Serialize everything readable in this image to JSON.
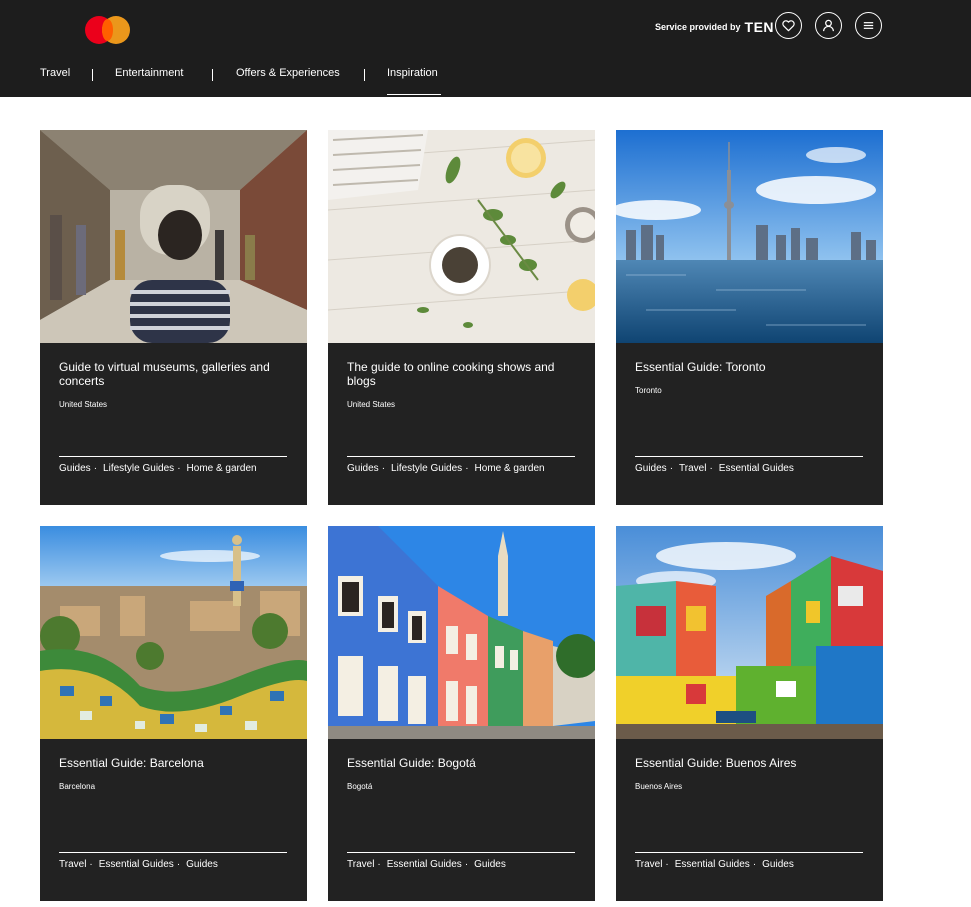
{
  "header": {
    "service_label": "Service provided by",
    "service_brand": "TEN",
    "logo_icon": "mastercard-logo",
    "buttons": [
      {
        "icon": "heart-icon"
      },
      {
        "icon": "user-icon"
      },
      {
        "icon": "menu-icon"
      }
    ],
    "nav": [
      {
        "label": "Travel",
        "active": false
      },
      {
        "label": "Entertainment",
        "active": false
      },
      {
        "label": "Offers & Experiences",
        "active": false
      },
      {
        "label": "Inspiration",
        "active": true
      }
    ]
  },
  "cards": [
    {
      "title": "Guide to virtual museums, galleries and concerts",
      "location": "United States",
      "image": "museum-hallway-photo",
      "tags": [
        "Guides",
        "Lifestyle Guides",
        "Home & garden"
      ]
    },
    {
      "title": "The guide to online cooking shows and blogs",
      "location": "United States",
      "image": "herbs-on-wooden-table-photo",
      "tags": [
        "Guides",
        "Lifestyle Guides",
        "Home & garden"
      ]
    },
    {
      "title": "Essential Guide: Toronto",
      "location": "Toronto",
      "image": "toronto-skyline-photo",
      "tags": [
        "Guides",
        "Travel",
        "Essential Guides"
      ]
    },
    {
      "title": "Essential Guide: Barcelona",
      "location": "Barcelona",
      "image": "park-guell-photo",
      "tags": [
        "Travel",
        "Essential Guides",
        "Guides"
      ]
    },
    {
      "title": "Essential Guide: Bogotá",
      "location": "Bogotá",
      "image": "colorful-colonial-street-photo",
      "tags": [
        "Travel",
        "Essential Guides",
        "Guides"
      ]
    },
    {
      "title": "Essential Guide: Buenos Aires",
      "location": "Buenos Aires",
      "image": "la-boca-houses-photo",
      "tags": [
        "Travel",
        "Essential Guides",
        "Guides"
      ]
    }
  ],
  "colors": {
    "header_bg": "#1d1d1d",
    "card_bg": "#222222",
    "page_bg": "#ffffff",
    "mastercard_red": "#eb001b",
    "mastercard_orange": "#f79e1b"
  }
}
